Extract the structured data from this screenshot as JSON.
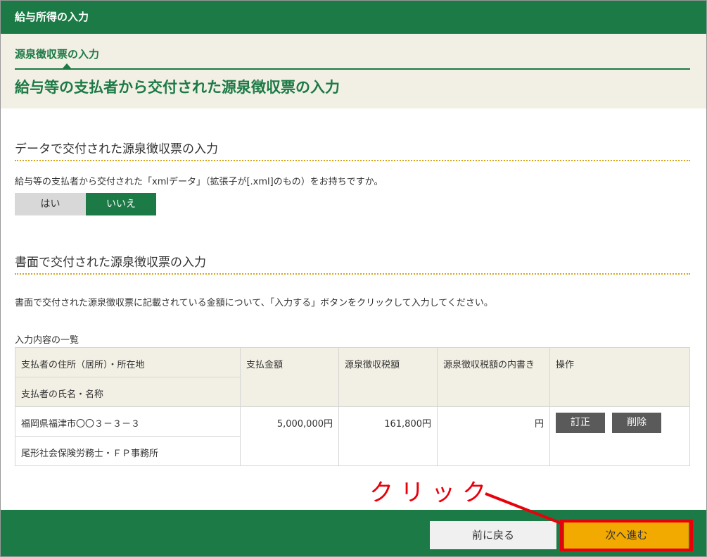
{
  "window": {
    "title": "給与所得の入力"
  },
  "header": {
    "step_label": "源泉徴収票の入力",
    "main_title": "給与等の支払者から交付された源泉徴収票の入力"
  },
  "data_section": {
    "heading": "データで交付された源泉徴収票の入力",
    "question": "給与等の支払者から交付された「xmlデータ」（拡張子が[.xml]のもの）をお持ちですか。",
    "yes_label": "はい",
    "no_label": "いいえ",
    "selected": "いいえ"
  },
  "paper_section": {
    "heading": "書面で交付された源泉徴収票の入力",
    "instruction": "書面で交付された源泉徴収票に記載されている金額について、「入力する」ボタンをクリックして入力してください。",
    "list_caption": "入力内容の一覧"
  },
  "table": {
    "headers": {
      "payer_address": "支払者の住所（居所）・所在地",
      "payer_name": "支払者の氏名・名称",
      "payment_amount": "支払金額",
      "withholding_tax": "源泉徴収税額",
      "withholding_breakdown": "源泉徴収税額の内書き",
      "operation": "操作"
    },
    "rows": [
      {
        "address": "福岡県福津市〇〇３－３－３",
        "name": "尾形社会保険労務士・ＦＰ事務所",
        "payment_amount": "5,000,000円",
        "withholding_tax": "161,800円",
        "withholding_breakdown": "円",
        "edit_label": "訂正",
        "delete_label": "削除"
      }
    ]
  },
  "footer": {
    "back_label": "前に戻る",
    "next_label": "次へ進む"
  },
  "annotation": {
    "text": "クリック",
    "color": "#e8000b"
  },
  "colors": {
    "brand_green": "#1b7a45",
    "header_bg": "#f2efe4",
    "next_button": "#f2a900",
    "dotted_divider": "#d4a51a"
  }
}
